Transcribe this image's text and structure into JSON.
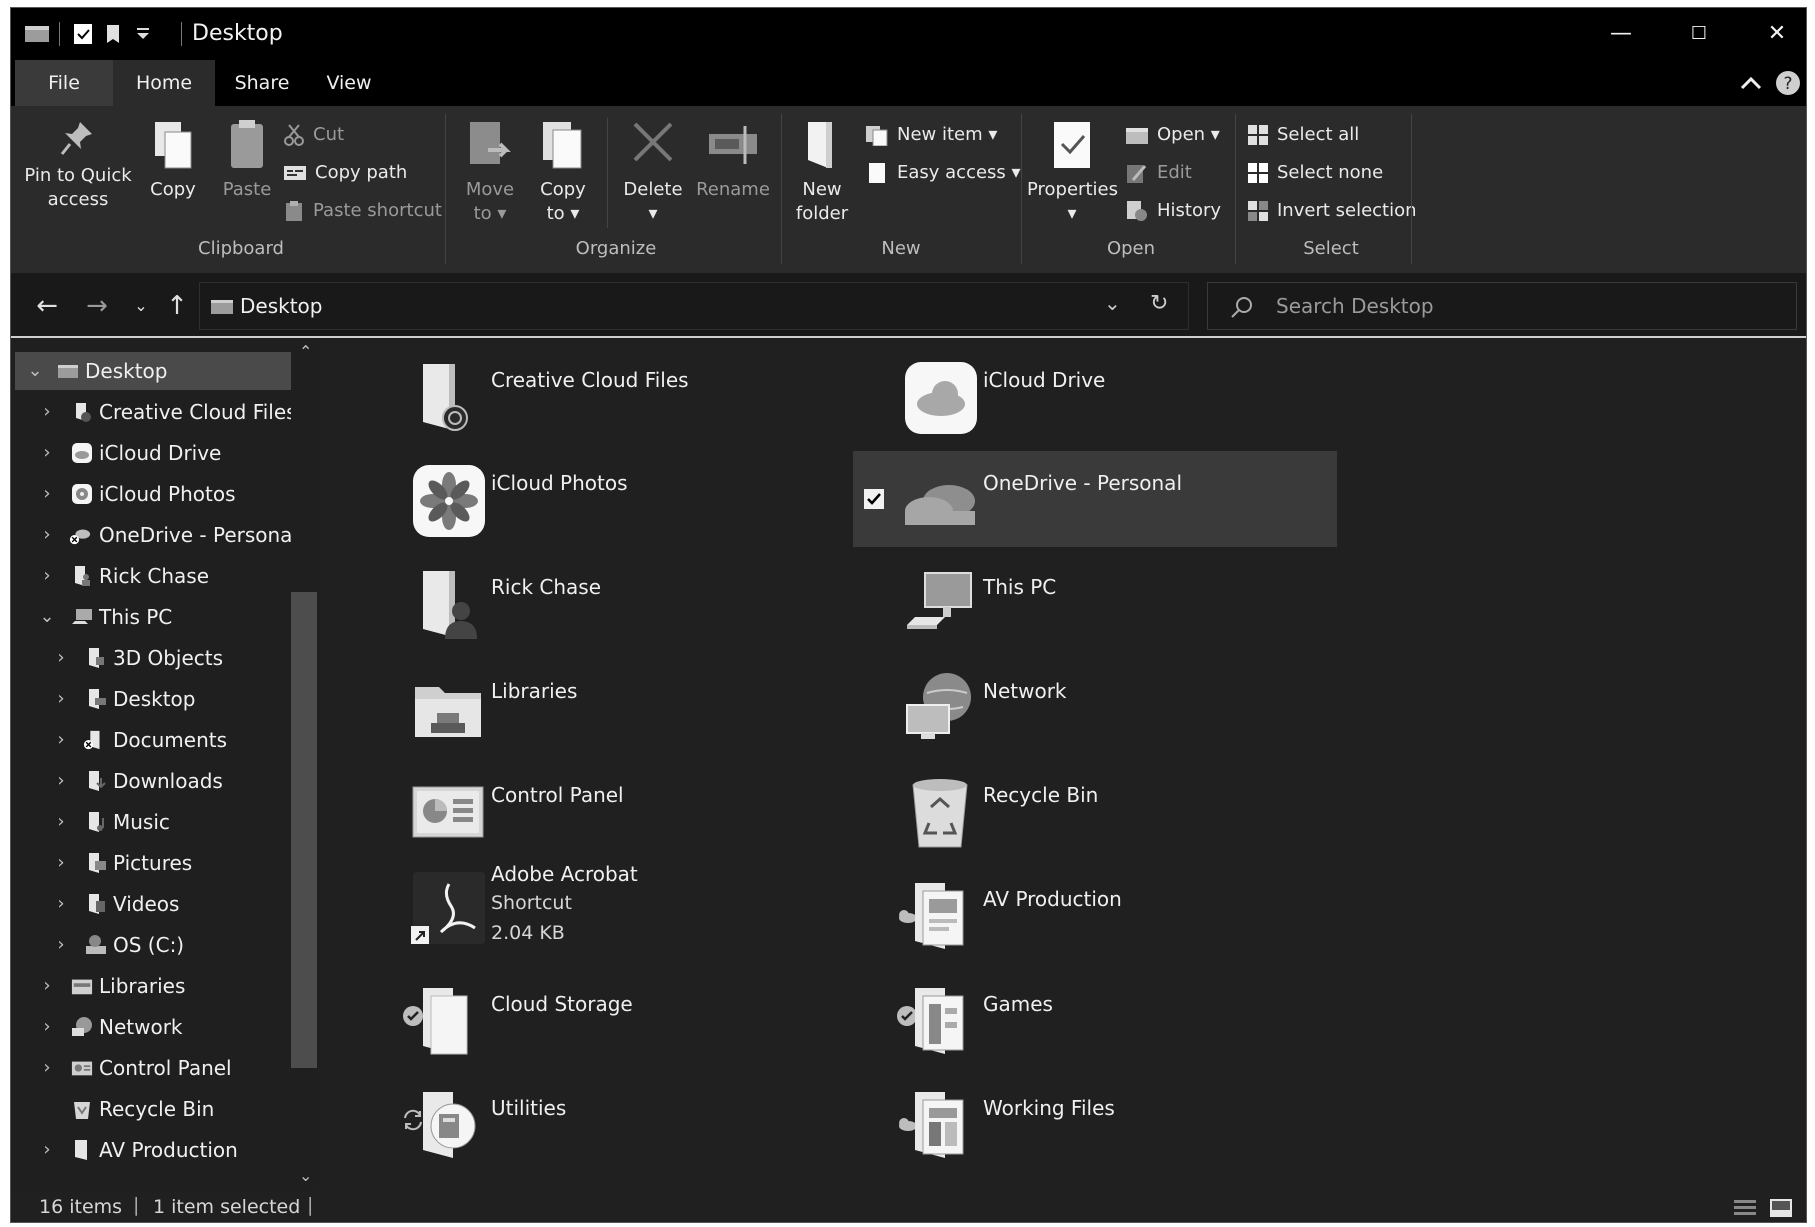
{
  "window": {
    "title": "Desktop"
  },
  "ribbon_tabs": [
    "File",
    "Home",
    "Share",
    "View"
  ],
  "ribbon": {
    "clipboard": {
      "pin_line1": "Pin to Quick",
      "pin_line2": "access",
      "copy": "Copy",
      "paste": "Paste",
      "cut": "Cut",
      "copy_path": "Copy path",
      "paste_shortcut": "Paste shortcut",
      "label": "Clipboard"
    },
    "organize": {
      "move_line1": "Move",
      "move_line2": "to",
      "copy_line1": "Copy",
      "copy_line2": "to",
      "delete": "Delete",
      "rename": "Rename",
      "label": "Organize"
    },
    "new": {
      "new_folder_line1": "New",
      "new_folder_line2": "folder",
      "new_item": "New item",
      "easy_access": "Easy access",
      "label": "New"
    },
    "open": {
      "properties": "Properties",
      "open": "Open",
      "edit": "Edit",
      "history": "History",
      "label": "Open"
    },
    "select": {
      "select_all": "Select all",
      "select_none": "Select none",
      "invert_selection": "Invert selection",
      "label": "Select"
    }
  },
  "address": {
    "path": "Desktop",
    "search_placeholder": "Search Desktop"
  },
  "nav_pane": {
    "items": [
      {
        "label": "Desktop",
        "icon": "desktop-icon"
      },
      {
        "label": "Creative Cloud Files",
        "icon": "creative-cloud-folder-icon"
      },
      {
        "label": "iCloud Drive",
        "icon": "icloud-drive-icon"
      },
      {
        "label": "iCloud Photos",
        "icon": "icloud-photos-icon"
      },
      {
        "label": "OneDrive - Personal",
        "icon": "onedrive-icon"
      },
      {
        "label": "Rick Chase",
        "icon": "user-folder-icon"
      },
      {
        "label": "This PC",
        "icon": "this-pc-icon"
      },
      {
        "label": "3D Objects",
        "icon": "3d-objects-icon"
      },
      {
        "label": "Desktop",
        "icon": "desktop-folder-icon"
      },
      {
        "label": "Documents",
        "icon": "documents-icon"
      },
      {
        "label": "Downloads",
        "icon": "downloads-icon"
      },
      {
        "label": "Music",
        "icon": "music-icon"
      },
      {
        "label": "Pictures",
        "icon": "pictures-icon"
      },
      {
        "label": "Videos",
        "icon": "videos-icon"
      },
      {
        "label": "OS (C:)",
        "icon": "drive-icon"
      },
      {
        "label": "Libraries",
        "icon": "libraries-icon"
      },
      {
        "label": "Network",
        "icon": "network-icon"
      },
      {
        "label": "Control Panel",
        "icon": "control-panel-icon"
      },
      {
        "label": "Recycle Bin",
        "icon": "recycle-bin-icon"
      },
      {
        "label": "AV Production",
        "icon": "folder-icon"
      }
    ]
  },
  "content": {
    "items": [
      {
        "name": "Creative Cloud Files",
        "icon": "creative-cloud-folder-icon"
      },
      {
        "name": "iCloud Drive",
        "icon": "icloud-drive-icon"
      },
      {
        "name": "iCloud Photos",
        "icon": "icloud-photos-icon"
      },
      {
        "name": "OneDrive - Personal",
        "icon": "onedrive-icon",
        "selected": true
      },
      {
        "name": "Rick Chase",
        "icon": "user-folder-icon"
      },
      {
        "name": "This PC",
        "icon": "this-pc-icon"
      },
      {
        "name": "Libraries",
        "icon": "libraries-icon"
      },
      {
        "name": "Network",
        "icon": "network-icon"
      },
      {
        "name": "Control Panel",
        "icon": "control-panel-icon"
      },
      {
        "name": "Recycle Bin",
        "icon": "recycle-bin-icon"
      },
      {
        "name": "Adobe Acrobat",
        "type": "Shortcut",
        "size": "2.04 KB",
        "icon": "adobe-acrobat-icon"
      },
      {
        "name": "AV Production",
        "icon": "folder-icon",
        "status": "cloud-icon"
      },
      {
        "name": "Cloud Storage",
        "icon": "folder-icon",
        "status": "synced-check-icon"
      },
      {
        "name": "Games",
        "icon": "folder-icon",
        "status": "synced-check-icon"
      },
      {
        "name": "Utilities",
        "icon": "folder-icon",
        "status": "sync-pending-icon"
      },
      {
        "name": "Working Files",
        "icon": "folder-icon",
        "status": "cloud-icon"
      }
    ]
  },
  "status_bar": {
    "item_count": "16 items",
    "selection": "1 item selected"
  },
  "colors": {
    "window_bg": "#202020",
    "titlebar_bg": "#000000",
    "ribbon_bg": "#2b2b2b",
    "selection_bg": "#3a3a3a",
    "text": "#f0f0f0"
  }
}
